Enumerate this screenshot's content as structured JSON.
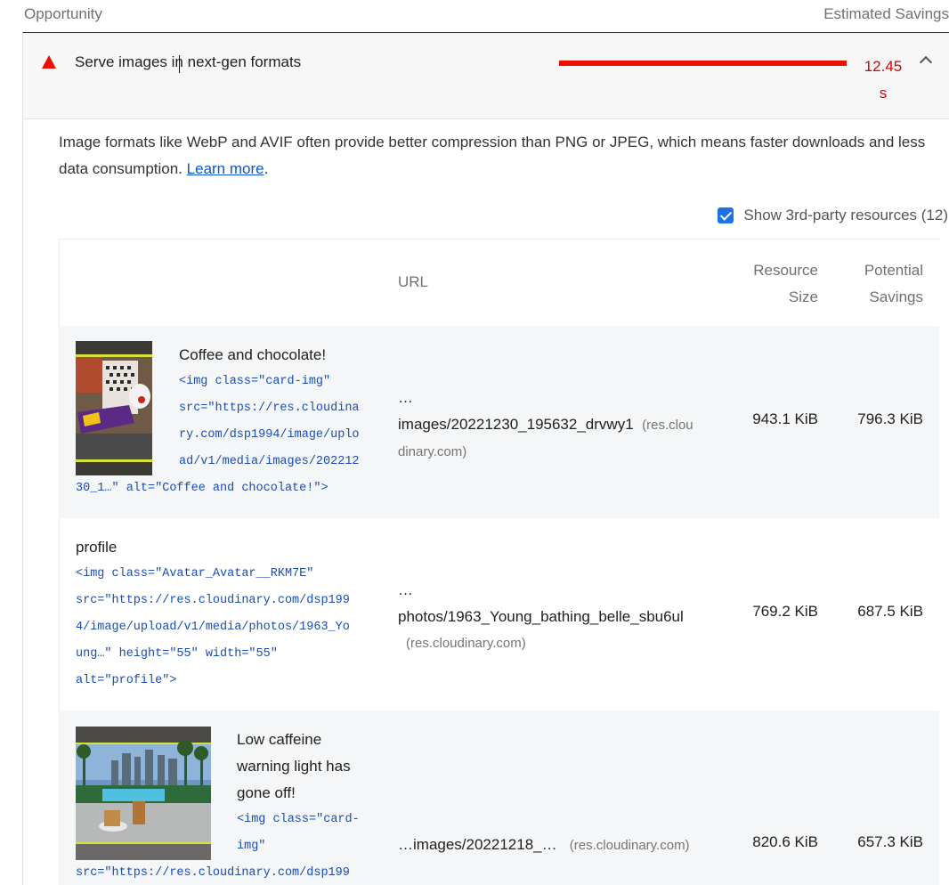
{
  "columns": {
    "left": "Opportunity",
    "right": "Estimated Savings"
  },
  "audit": {
    "title": "Serve images in next-gen formats",
    "savings_value": "12.45",
    "savings_unit": "s",
    "description_text": "Image formats like WebP and AVIF often provide better compression than PNG or JPEG, which means faster downloads and less data consumption. ",
    "learn_more": "Learn more",
    "description_end": ".",
    "third_party_label": "Show 3rd-party resources (12)",
    "colors": {
      "fail": "#eb0f00",
      "bar": "#eb0f00",
      "savings": "#d50000",
      "checkbox": "#1a73e8"
    }
  },
  "table": {
    "headers": {
      "url": "URL",
      "size_1": "Resource",
      "size_2": "Size",
      "pot_1": "Potential",
      "pot_2": "Savings"
    },
    "rows": [
      {
        "label": "Coffee and chocolate!",
        "code": [
          "<img class=\"card-img\"",
          "src=\"https://res.cloudina",
          "ry.com/dsp1994/image/uplo",
          "ad/v1/media/images/202212",
          "30_1…\" alt=\"Coffee and chocolate!\">"
        ],
        "url_prefix": "…",
        "url": "images/20221230_195632_drvwy1",
        "host_1": "(res.clou",
        "host_2": "dinary.com)",
        "size": "943.1 KiB",
        "savings": "796.3 KiB"
      },
      {
        "label": "profile",
        "code": [
          "<img class=\"Avatar_Avatar__RKM7E\"",
          "src=\"https://res.cloudinary.com/dsp199",
          "4/image/upload/v1/media/photos/1963_Yo",
          "ung…\" height=\"55\" width=\"55\"",
          "alt=\"profile\">"
        ],
        "url_prefix": "…",
        "url": "photos/1963_Young_bathing_belle_sbu6ul",
        "host": "(res.cloudinary.com)",
        "size": "769.2 KiB",
        "savings": "687.5 KiB"
      },
      {
        "label_lines": [
          "Low caffeine",
          "warning light has",
          "gone off!"
        ],
        "code": [
          "<img class=\"card-",
          "img\"",
          "src=\"https://res.cloudinary.com/dsp199"
        ],
        "url": "…images/20221218_…",
        "host": "(res.cloudinary.com)",
        "size": "820.6 KiB",
        "savings": "657.3 KiB"
      }
    ]
  }
}
